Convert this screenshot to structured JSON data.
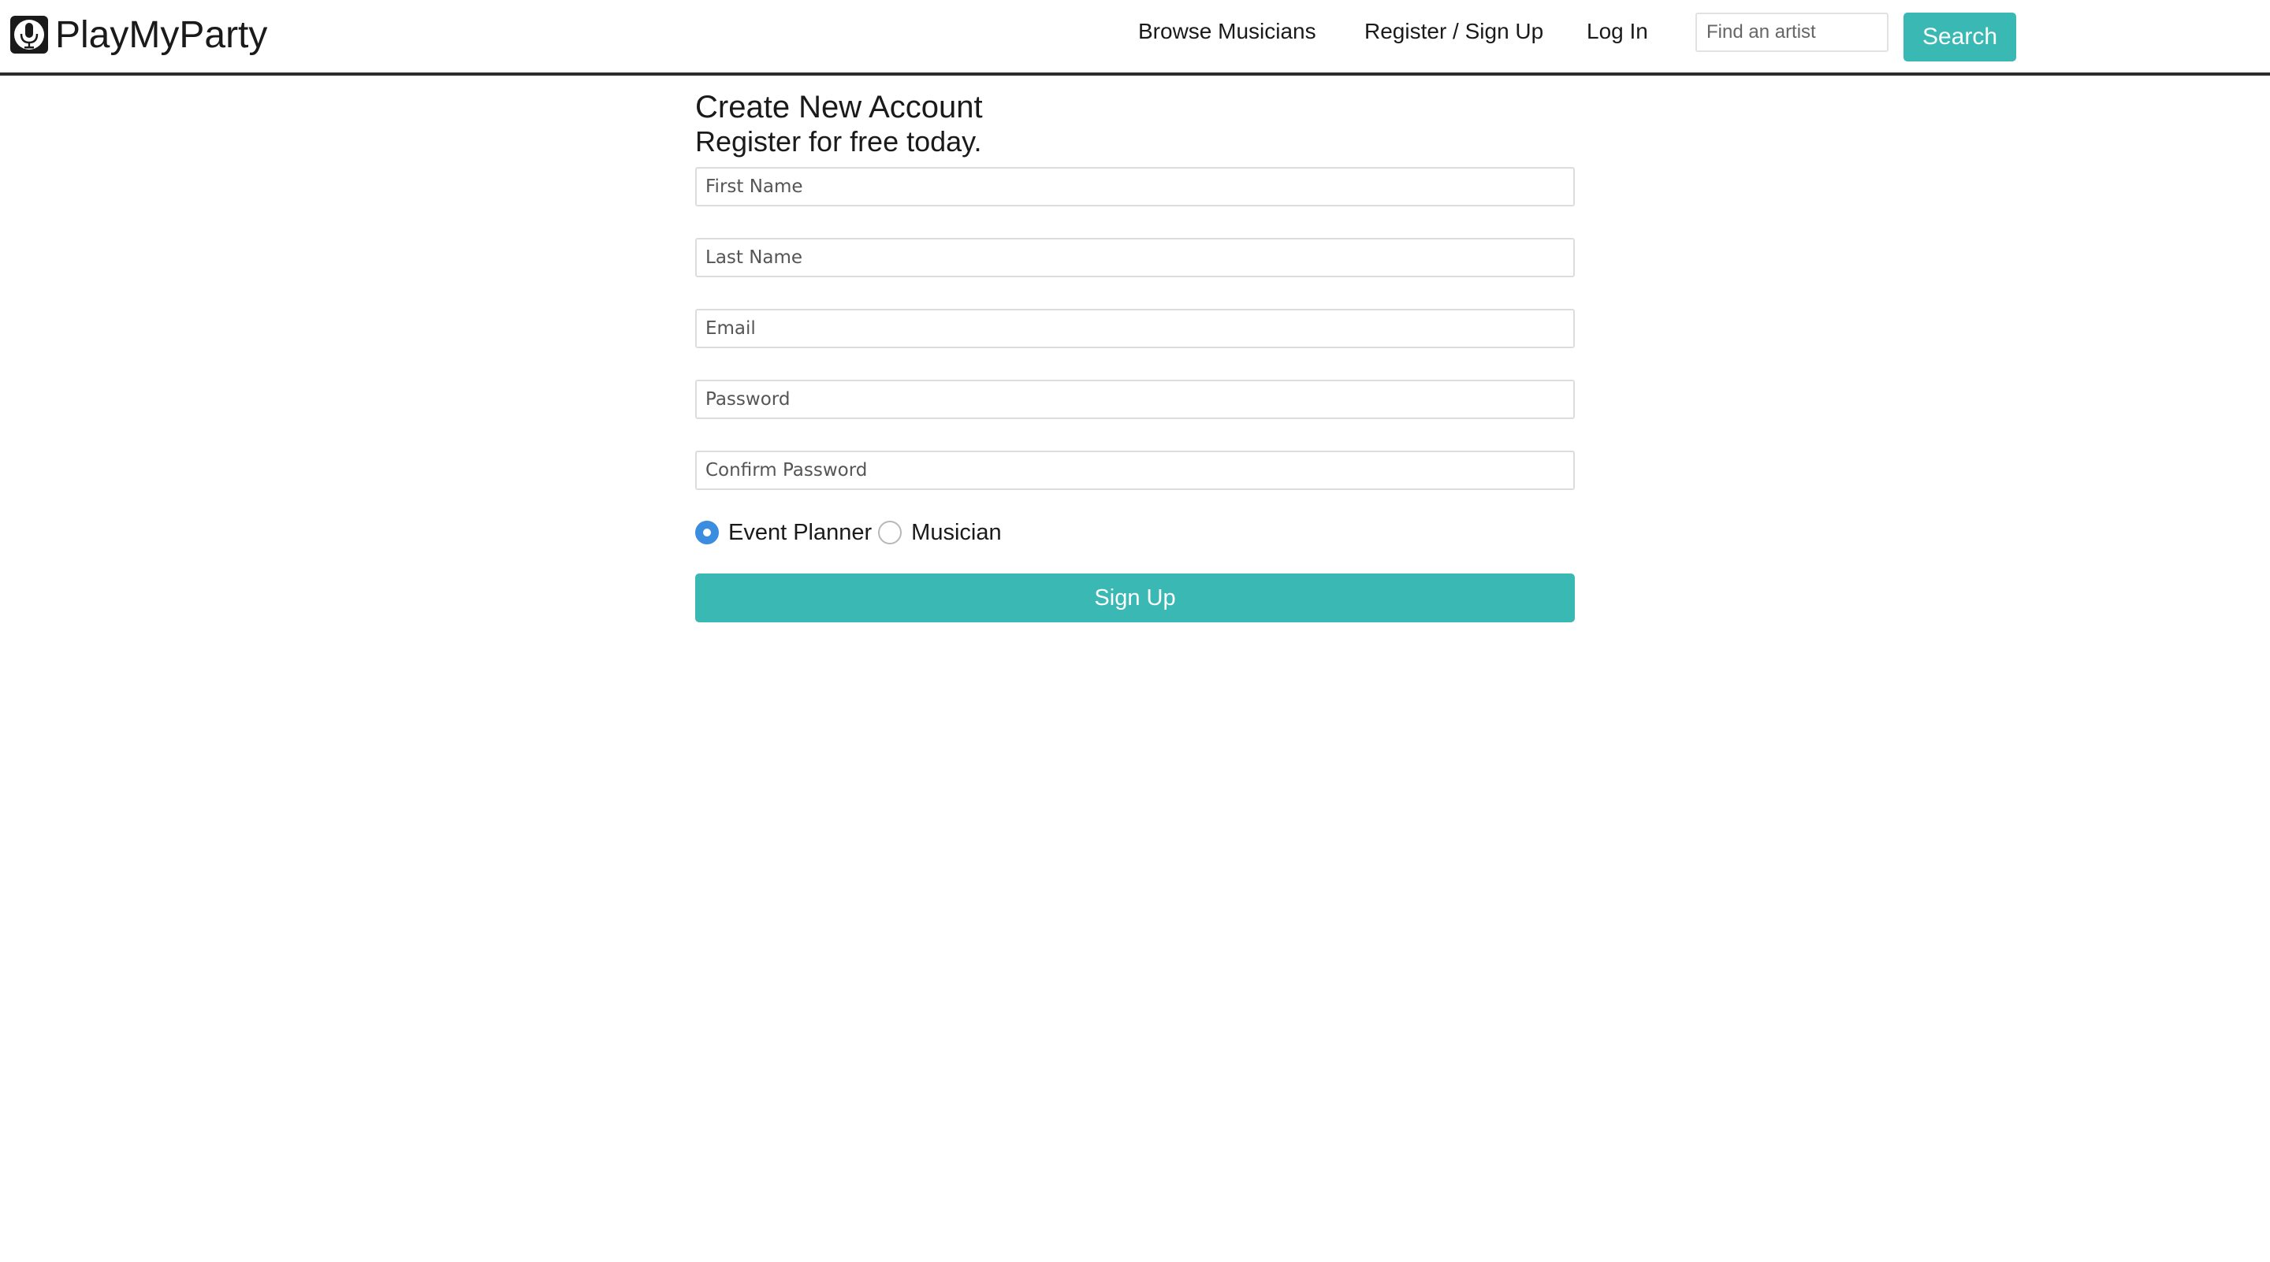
{
  "header": {
    "brand_name": "PlayMyParty",
    "brand_icon": "microphone-icon",
    "nav": {
      "browse_label": "Browse Musicians",
      "register_label": "Register / Sign Up",
      "login_label": "Log In"
    },
    "search": {
      "placeholder": "Find an artist",
      "value": "",
      "button_label": "Search"
    }
  },
  "form": {
    "title": "Create New Account",
    "subtitle": "Register for free today.",
    "fields": {
      "first_name_placeholder": "First Name",
      "last_name_placeholder": "Last Name",
      "email_placeholder": "Email",
      "password_placeholder": "Password",
      "confirm_password_placeholder": "Confirm Password"
    },
    "account_type": {
      "options": [
        "Event Planner",
        "Musician"
      ],
      "selected": "Event Planner"
    },
    "submit_label": "Sign Up"
  },
  "colors": {
    "accent": "#3ab8b4",
    "radio_selected": "#3b8de0",
    "header_border": "#2b2b2b"
  }
}
